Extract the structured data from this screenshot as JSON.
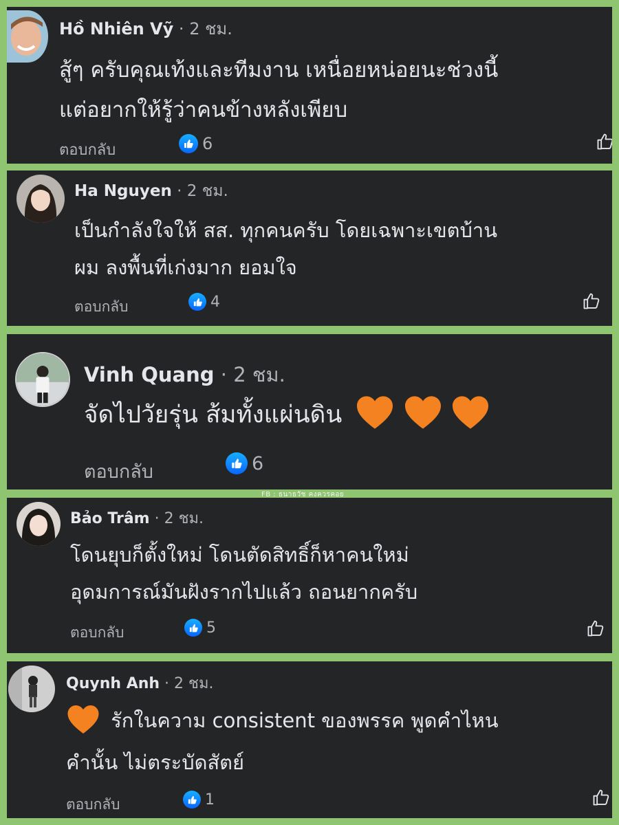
{
  "comments": [
    {
      "name": "Hồ Nhiên Vỹ",
      "separator": "·",
      "time": "2 ชม.",
      "line1": "สู้ๆ ครับคุณเท้งและทีมงาน เหนื่อยหน่อยนะช่วงนี้",
      "line2": "แต่อยากให้รู้ว่าคนข้างหลังเพียบ",
      "reply": "ตอบกลับ",
      "likes": "6"
    },
    {
      "name": "Ha Nguyen",
      "separator": "·",
      "time": "2 ชม.",
      "line1": "เป็นกำลังใจให้ สส. ทุกคนครับ โดยเฉพาะเขตบ้าน",
      "line2": "ผม ลงพื้นที่เก่งมาก ยอมใจ",
      "reply": "ตอบกลับ",
      "likes": "4"
    },
    {
      "name": "Vinh Quang",
      "separator": "·",
      "time": "2 ชม.",
      "line1": "จัดไปวัยรุ่น ส้มทั้งแผ่นดิน",
      "reply": "ตอบกลับ",
      "likes": "6",
      "hearts": 3
    },
    {
      "name": "Bảo Trâm",
      "separator": "·",
      "time": "2 ชม.",
      "line1": "โดนยุบก็ตั้งใหม่ โดนตัดสิทธิ์ก็หาคนใหม่",
      "line2": "อุดมการณ์มันฝังรากไปแล้ว ถอนยากครับ",
      "reply": "ตอบกลับ",
      "likes": "5"
    },
    {
      "name": "Quynh Anh",
      "separator": "·",
      "time": "2 ชม.",
      "line1": "รักในความ consistent ของพรรค พูดคำไหน",
      "line2": "คำนั้น ไม่ตระบัดสัตย์",
      "reply": "ตอบกลับ",
      "likes": "1",
      "hearts": 1
    }
  ],
  "watermark": "FB : ธนาธวัช คงควรคอย",
  "colors": {
    "background": "#8fc470",
    "card": "#242526",
    "text": "#e4e6eb",
    "muted": "#b0b3b8",
    "like_blue": "#0866ff",
    "heart_orange": "#f58220"
  },
  "icons": [
    "like-badge-icon",
    "thumbs-up-outline-icon",
    "orange-heart-icon",
    "avatar"
  ]
}
